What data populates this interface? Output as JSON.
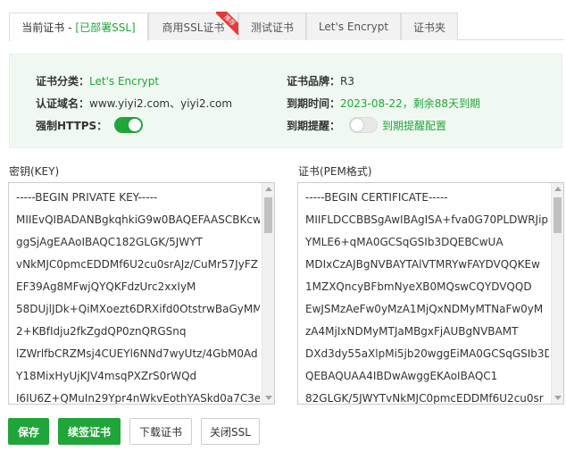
{
  "tabs": [
    {
      "label": "当前证书 - ",
      "extra": "[已部署SSL]"
    },
    {
      "label": "商用SSL证书",
      "badge": "推荐"
    },
    {
      "label": "测试证书"
    },
    {
      "label": "Let's Encrypt"
    },
    {
      "label": "证书夹"
    }
  ],
  "info": {
    "category_label": "证书分类：",
    "category_value": "Let's Encrypt",
    "brand_label": "证书品牌：",
    "brand_value": "R3",
    "domain_label": "认证域名：",
    "domain_value": "www.yiyi2.com、yiyi2.com",
    "expire_label": "到期时间：",
    "expire_value": "2023-08-22，剩余88天到期",
    "https_label": "强制HTTPS：",
    "https_on": true,
    "remind_label": "到期提醒：",
    "remind_on": false,
    "remind_link": "到期提醒配置"
  },
  "key": {
    "label": "密钥(KEY)",
    "lines": [
      "-----BEGIN PRIVATE KEY-----",
      "MIIEvQIBADANBgkqhkiG9w0BAQEFAASCBKcw",
      "ggSjAgEAAoIBAQC182GLGK/5JWYT",
      "vNkMJC0pmcEDDMf6U2cu0srAJz/CuMr57JyFZ",
      "EF39Ag8MFwjQYQKFdzUrc2xxIyM",
      "58DUjlJDk+QiMXoezt6DRXifd0OtstrwBaGyMM",
      "2+KBfIdju2fkZgdQP0znQRGSnq",
      "lZWrlfbCRZMsj4CUEYl6NNd7wyUtz/4GbM0Ad",
      "Y18MixHyUjKJV4msqPXZrS0rWQd",
      "I6IU6Z+QMuIn29Ypr4nWkvEothYASkd0a7C3e"
    ]
  },
  "cert": {
    "label": "证书(PEM格式)",
    "lines": [
      "-----BEGIN CERTIFICATE-----",
      "MIIFLDCCBBSgAwIBAgISA+fva0G70PLDWRJip",
      "YMLE6+qMA0GCSqGSIb3DQEBCwUA",
      "MDIxCzAJBgNVBAYTAlVTMRYwFAYDVQQKEw",
      "1MZXQncyBFbmNyeXB0MQswCQYDVQQD",
      "EwJSMzAeFw0yMzA1MjQxNDMyMTNaFw0yM",
      "zA4MjIxNDMyMTJaMBgxFjAUBgNVBAMT",
      "DXd3dy55aXlpMi5jb20wggEiMA0GCSqGSIb3D",
      "QEBAQUAA4IBDwAwggEKAoIBAQC1",
      "82GLGK/5JWYTvNkMJC0pmcEDDMf6U2cu0sr"
    ]
  },
  "buttons": {
    "save": "保存",
    "renew": "续签证书",
    "download": "下载证书",
    "close": "关闭SSL"
  },
  "colors": {
    "accent": "#20a53a",
    "badge": "#e23b3b",
    "panel_bg": "#f0f9f1"
  }
}
